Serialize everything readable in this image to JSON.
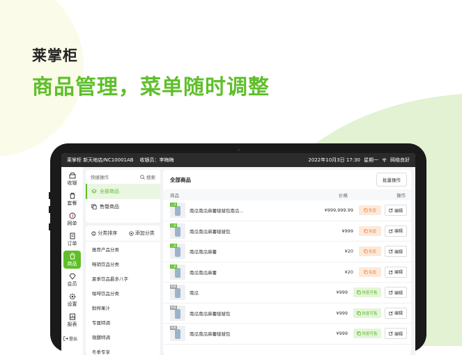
{
  "hero": {
    "brand": "莱掌柜",
    "slogan": "商品管理，菜单随时调整"
  },
  "colors": {
    "accent": "#5fbf2b",
    "dark": "#2b2b2b",
    "sold_out_bg": "#fde9d9",
    "sold_out_fg": "#f0955a"
  },
  "statusbar": {
    "store": "莱掌柜 新天地店/NC10001AB",
    "cashier": "收银员：李梅梅",
    "datetime": "2022年10月3日 17:30",
    "weekday": "星期一",
    "network": "网络良好"
  },
  "nav": {
    "items": [
      {
        "label": "收银",
        "icon": "register-icon"
      },
      {
        "label": "套餐",
        "icon": "combo-icon"
      },
      {
        "label": "网单",
        "icon": "online-order-icon"
      },
      {
        "label": "订单",
        "icon": "order-icon"
      },
      {
        "label": "商品",
        "icon": "goods-icon"
      },
      {
        "label": "会员",
        "icon": "member-icon"
      },
      {
        "label": "设置",
        "icon": "settings-icon"
      },
      {
        "label": "报表",
        "icon": "report-icon"
      }
    ],
    "active_index": 4,
    "logout": "登出"
  },
  "quick": {
    "title": "快捷操作",
    "search": "搜索",
    "items": [
      {
        "label": "全部商品",
        "active": true
      },
      {
        "label": "售罄商品",
        "active": false
      }
    ]
  },
  "categories": {
    "sort_label": "分类排序",
    "add_label": "添加分类",
    "items": [
      "推荐产品分类",
      "畅销饮品分类",
      "夏季饮品最多八字",
      "咖啡饮品分类",
      "鲜榨果汁",
      "专属特调",
      "微醺特调",
      "冬季专享"
    ]
  },
  "main": {
    "title": "全部商品",
    "batch": "批量操作",
    "columns": {
      "name": "商品",
      "price": "价格",
      "actions": "操作"
    },
    "sold_out_label": "售罄",
    "restore_label": "恢复可售",
    "edit_label": "编辑",
    "tag_on": "上架",
    "tag_off": "售罄",
    "rows": [
      {
        "name": "南瓜南瓜麻薯啵啵包南瓜...",
        "price": "¥999,999.99",
        "status": "on"
      },
      {
        "name": "南瓜南瓜麻薯啵啵包",
        "price": "¥999",
        "status": "on"
      },
      {
        "name": "南瓜南瓜麻薯",
        "price": "¥20",
        "status": "on"
      },
      {
        "name": "南瓜南瓜麻薯",
        "price": "¥20",
        "status": "on"
      },
      {
        "name": "南瓜",
        "price": "¥999",
        "status": "off"
      },
      {
        "name": "南瓜南瓜麻薯啵啵包",
        "price": "¥999",
        "status": "off"
      },
      {
        "name": "南瓜南瓜麻薯啵啵包",
        "price": "¥999",
        "status": "off"
      }
    ]
  }
}
